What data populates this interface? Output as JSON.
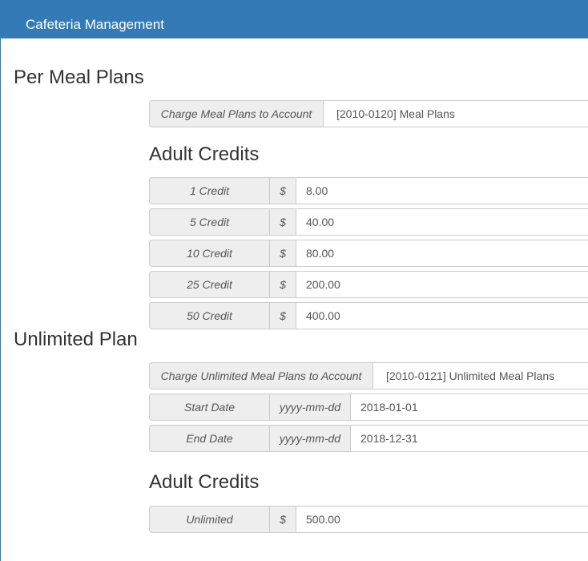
{
  "header": {
    "title": "Cafeteria Management"
  },
  "per_meal": {
    "title": "Per Meal Plans",
    "account_label": "Charge Meal Plans to Account",
    "account_value": "[2010-0120] Meal Plans",
    "credits_title": "Adult Credits",
    "credits": [
      {
        "label": "1 Credit",
        "currency": "$",
        "value": "8.00"
      },
      {
        "label": "5 Credit",
        "currency": "$",
        "value": "40.00"
      },
      {
        "label": "10 Credit",
        "currency": "$",
        "value": "80.00"
      },
      {
        "label": "25 Credit",
        "currency": "$",
        "value": "200.00"
      },
      {
        "label": "50 Credit",
        "currency": "$",
        "value": "400.00"
      }
    ]
  },
  "unlimited": {
    "title": "Unlimited Plan",
    "account_label": "Charge Unlimited Meal Plans to Account",
    "account_value": "[2010-0121] Unlimited Meal Plans",
    "start_label": "Start Date",
    "start_format": "yyyy-mm-dd",
    "start_value": "2018-01-01",
    "end_label": "End Date",
    "end_format": "yyyy-mm-dd",
    "end_value": "2018-12-31",
    "credits_title": "Adult Credits",
    "credit_label": "Unlimited",
    "credit_currency": "$",
    "credit_value": "500.00"
  }
}
